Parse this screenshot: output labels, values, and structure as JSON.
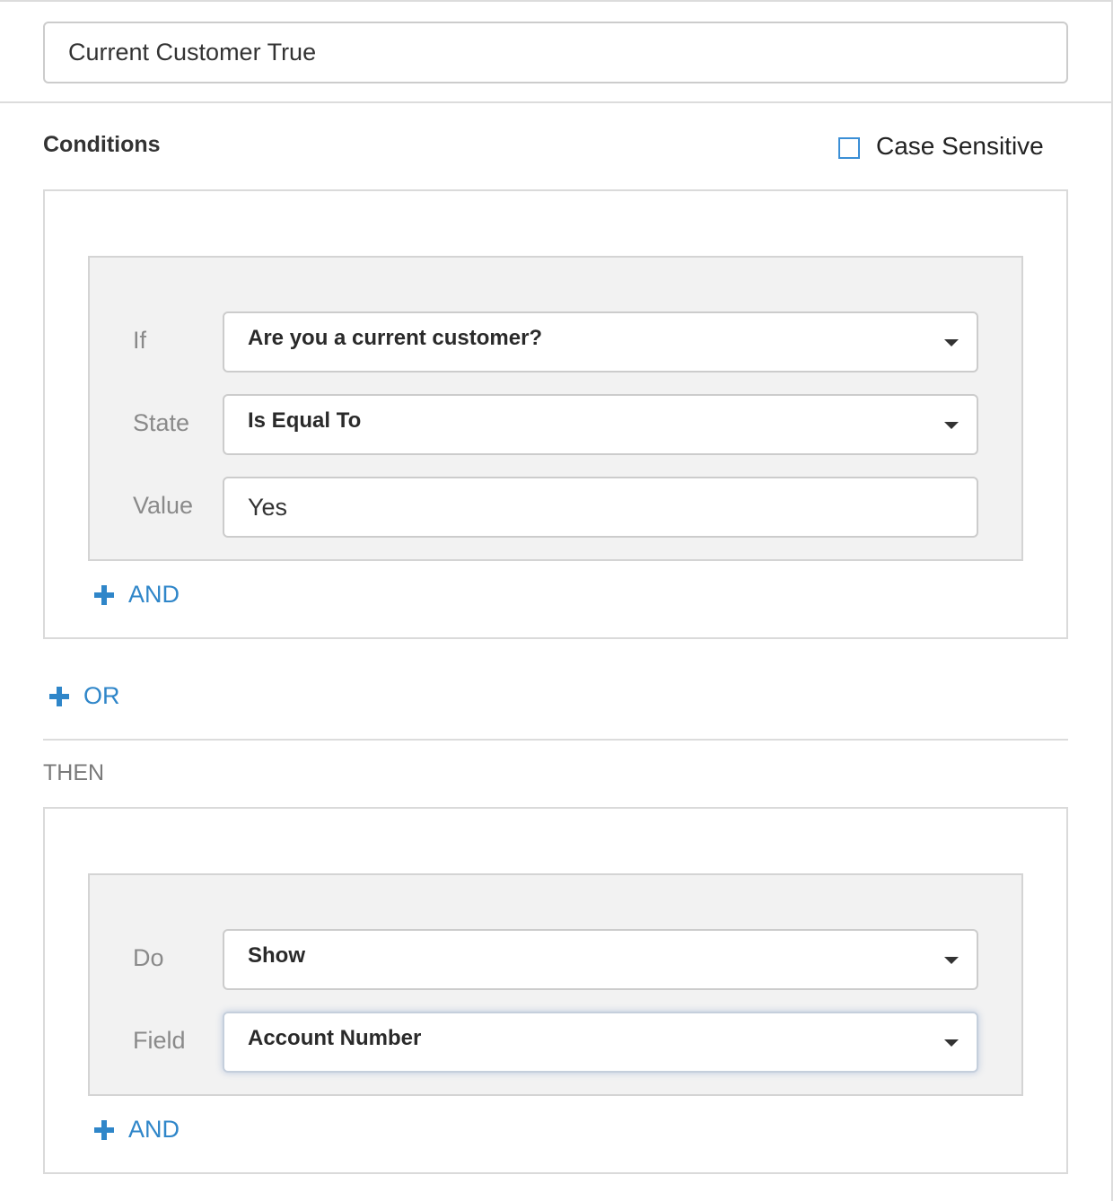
{
  "rule": {
    "name_value": "Current Customer True"
  },
  "conditions": {
    "title": "Conditions",
    "case_sensitive_label": "Case Sensitive",
    "case_sensitive_checked": false,
    "rows": {
      "if_label": "If",
      "if_value": "Are you a current customer?",
      "state_label": "State",
      "state_value": "Is Equal To",
      "value_label": "Value",
      "value_value": "Yes"
    },
    "and_label": "AND",
    "or_label": "OR"
  },
  "then": {
    "title": "THEN",
    "rows": {
      "do_label": "Do",
      "do_value": "Show",
      "field_label": "Field",
      "field_value": "Account Number"
    },
    "and_label": "AND"
  },
  "colors": {
    "accent": "#2f86c9",
    "checkbox_border": "#3b8fd6",
    "panel_bg": "#f2f2f2",
    "label_gray": "#8a8a8a"
  }
}
